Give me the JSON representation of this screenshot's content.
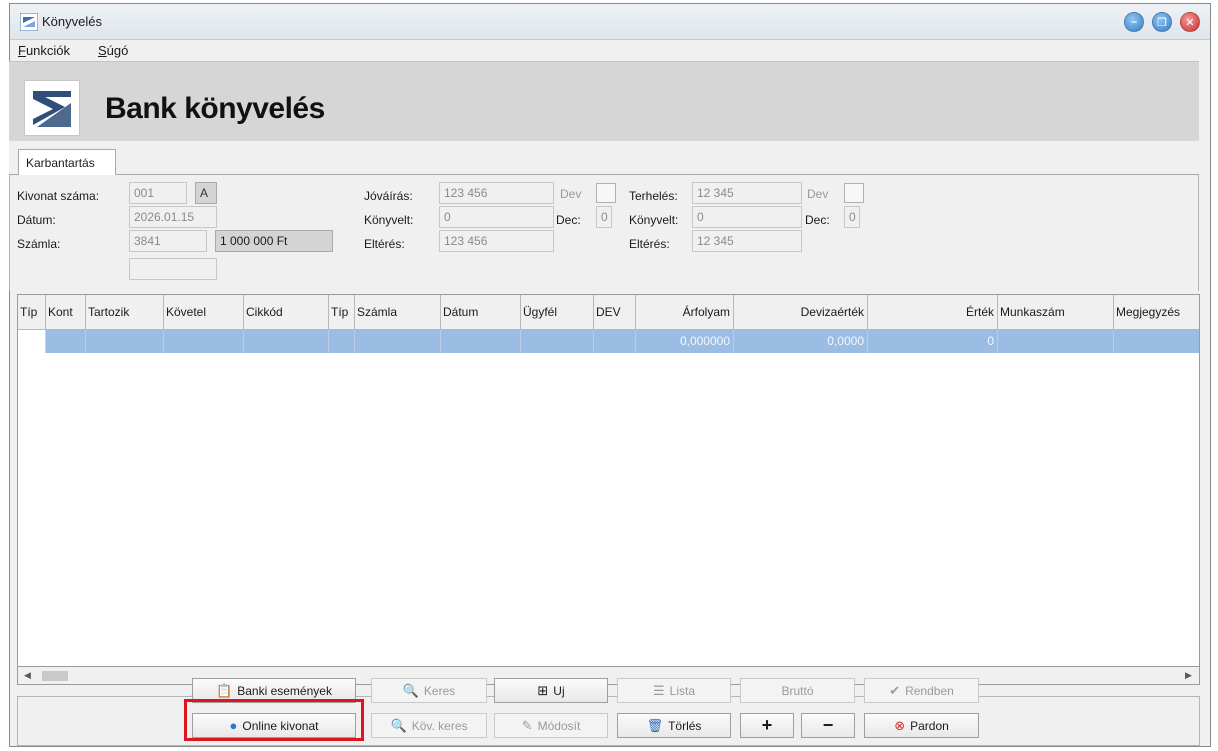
{
  "window": {
    "title": "Könyvelés"
  },
  "menu": [
    "Funkciók",
    "Súgó"
  ],
  "header": {
    "title": "Bank könyvelés"
  },
  "tabs": [
    {
      "label": "Karbantartás"
    }
  ],
  "form": {
    "kivonat_label": "Kivonat száma:",
    "kivonat_value": "001",
    "kivonat_suffix": "A",
    "datum_label": "Dátum:",
    "datum_value": "2026.01.15",
    "szamla_label": "Számla:",
    "szamla_value": "3841",
    "szamla_amount": "1 000 000 Ft",
    "jovairas_label": "Jóváírás:",
    "jovairas_value": "123 456",
    "dev_label_1": "Dev",
    "konyvelt_label_1": "Könyvelt:",
    "konyvelt_value_1": "0",
    "dec_label_1": "Dec:",
    "dec_value_1": "0",
    "elteres_label_1": "Eltérés:",
    "elteres_value_1": "123 456",
    "terheles_label": "Terhelés:",
    "terheles_value": "12 345",
    "dev_label_2": "Dev",
    "konyvelt_label_2": "Könyvelt:",
    "konyvelt_value_2": "0",
    "dec_label_2": "Dec:",
    "dec_value_2": "0",
    "elteres_label_2": "Eltérés:",
    "elteres_value_2": "12 345"
  },
  "grid": {
    "columns": [
      "Típ",
      "Kont",
      "Tartozik",
      "Követel",
      "Cikkód",
      "Típ",
      "Számla",
      "Dátum",
      "Ügyfél",
      "DEV",
      "Árfolyam",
      "Devizaérték",
      "Érték",
      "Munkaszám",
      "Megjegyzés"
    ],
    "row": {
      "arfolyam": "0,000000",
      "devizaertek": "0,0000",
      "ertek": "0"
    }
  },
  "buttons": {
    "banki_esemenyek": "Banki események",
    "online_kivonat": "Online kivonat",
    "keres": "Keres",
    "kov_keres": "Köv. keres",
    "uj": "Uj",
    "modosit": "Módosít",
    "lista": "Lista",
    "torles": "Törlés",
    "brutto": "Bruttó",
    "plus": "+",
    "minus": "−",
    "rendben": "Rendben",
    "pardon": "Pardon"
  },
  "colors": {
    "selected_row": "#9bbde3",
    "highlight_border": "#e0141e",
    "header_bg": "#d6d6d6"
  }
}
